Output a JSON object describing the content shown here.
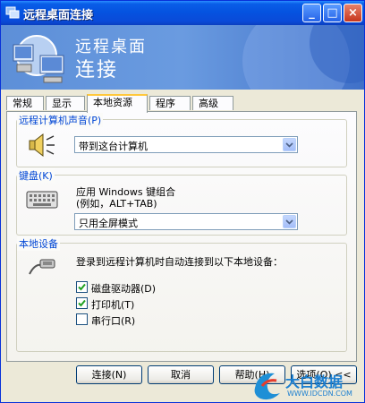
{
  "window": {
    "title": "远程桌面连接",
    "controls": {
      "minimize": "_",
      "maximize": "□",
      "close": "×"
    }
  },
  "banner": {
    "line1": "远程桌面",
    "line2": "连接"
  },
  "tabs": [
    {
      "label": "常规",
      "active": false
    },
    {
      "label": "显示",
      "active": false
    },
    {
      "label": "本地资源",
      "active": true
    },
    {
      "label": "程序",
      "active": false
    },
    {
      "label": "高级",
      "active": false
    }
  ],
  "sound": {
    "legend": "远程计算机声音(P)",
    "icon": "speaker-icon",
    "selected": "带到这台计算机"
  },
  "keyboard": {
    "legend": "键盘(K)",
    "icon": "keyboard-icon",
    "desc_line1": "应用 Windows 键组合",
    "desc_line2": "(例如，ALT+TAB)",
    "selected": "只用全屏模式"
  },
  "devices": {
    "legend": "本地设备",
    "icon": "device-cable-icon",
    "desc": "登录到远程计算机时自动连接到以下本地设备：",
    "items": [
      {
        "label": "磁盘驱动器(D)",
        "checked": true
      },
      {
        "label": "打印机(T)",
        "checked": true
      },
      {
        "label": "串行口(R)",
        "checked": false
      }
    ]
  },
  "buttons": {
    "connect": "连接(N)",
    "cancel": "取消",
    "help": "帮助(H)",
    "options": "选项(O) <<"
  },
  "watermark": {
    "text1": "大白数据",
    "text2": "WWW.IDCDN.COM"
  },
  "colors": {
    "titlebar": "#0a5ee8",
    "legend": "#0046d5",
    "tab_highlight": "#ffc83c"
  }
}
